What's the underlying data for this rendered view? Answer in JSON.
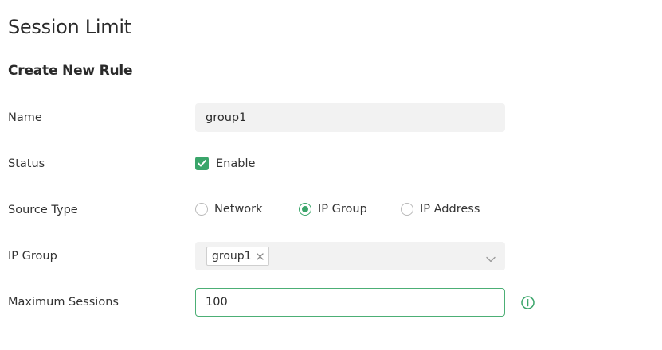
{
  "page": {
    "title": "Session Limit",
    "section_title": "Create New Rule"
  },
  "form": {
    "name": {
      "label": "Name",
      "value": "group1"
    },
    "status": {
      "label": "Status",
      "checkbox_label": "Enable",
      "checked": true
    },
    "source_type": {
      "label": "Source Type",
      "options": [
        "Network",
        "IP Group",
        "IP Address"
      ],
      "selected": "IP Group"
    },
    "ip_group": {
      "label": "IP Group",
      "selected_tag": "group1"
    },
    "max_sessions": {
      "label": "Maximum Sessions",
      "value": "100"
    }
  },
  "icons": {
    "check": "check-icon",
    "tag_close": "close-icon",
    "dropdown": "chevron-down-icon",
    "info": "info-icon"
  },
  "colors": {
    "accent": "#3aa56a",
    "input_bg": "#f2f2f2",
    "focus_border": "#4caf75"
  }
}
